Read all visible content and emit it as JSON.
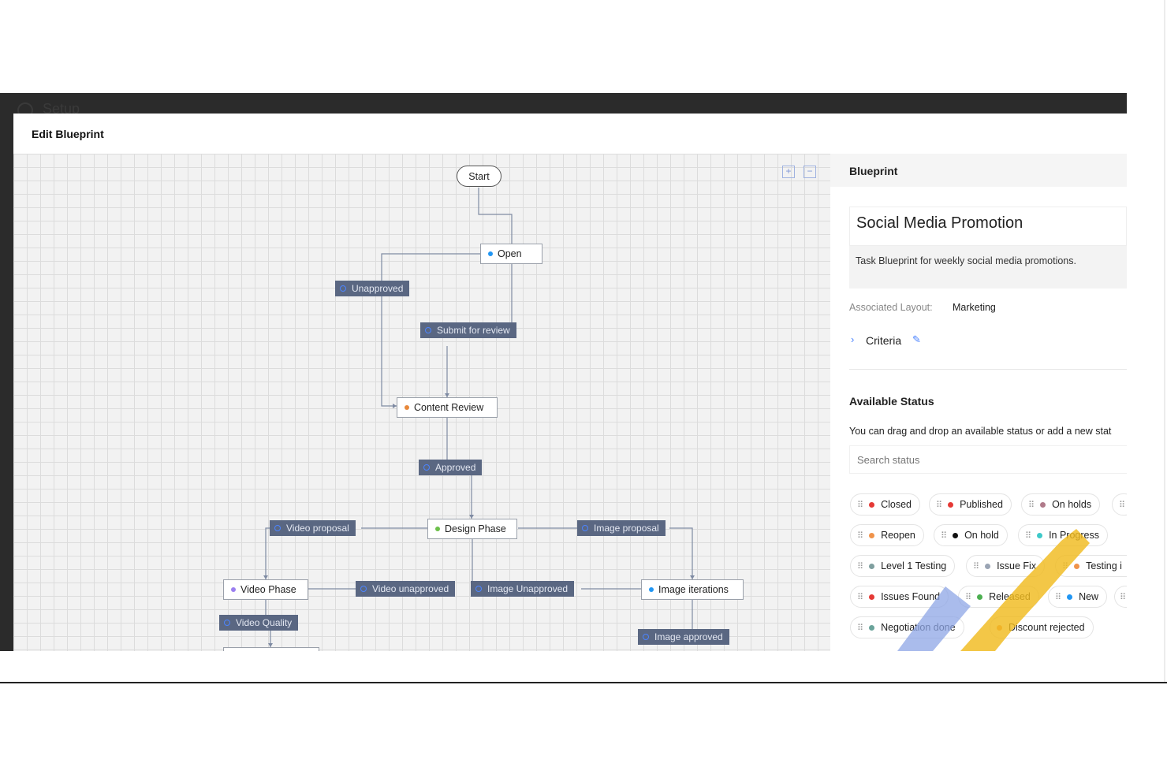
{
  "window": {
    "title": "Setup"
  },
  "editor": {
    "title": "Edit Blueprint"
  },
  "zoom": {
    "in": "+",
    "out": "−"
  },
  "diagram": {
    "nodes": [
      {
        "id": "start",
        "label": "Start",
        "color": ""
      },
      {
        "id": "open",
        "label": "Open",
        "color": "#2196f3"
      },
      {
        "id": "content-review",
        "label": "Content Review",
        "color": "#e8883a"
      },
      {
        "id": "design-phase",
        "label": "Design Phase",
        "color": "#6cc04a"
      },
      {
        "id": "video-phase",
        "label": "Video Phase",
        "color": "#9b7ff0"
      },
      {
        "id": "image-iterations",
        "label": "Image iterations",
        "color": "#2196f3"
      }
    ],
    "transitions": [
      {
        "id": "unapproved",
        "label": "Unapproved"
      },
      {
        "id": "submit-for-review",
        "label": "Submit for review"
      },
      {
        "id": "approved",
        "label": "Approved"
      },
      {
        "id": "video-proposal",
        "label": "Video proposal"
      },
      {
        "id": "image-proposal",
        "label": "Image proposal"
      },
      {
        "id": "video-unapproved",
        "label": "Video unapproved"
      },
      {
        "id": "image-unapproved",
        "label": "Image Unapproved"
      },
      {
        "id": "video-quality",
        "label": "Video Quality"
      },
      {
        "id": "image-approved",
        "label": "Image approved"
      }
    ]
  },
  "sidebar": {
    "header": "Blueprint",
    "name": "Social Media Promotion",
    "description": "Task Blueprint for weekly social media promotions.",
    "associated_layout_label": "Associated Layout:",
    "associated_layout_value": "Marketing",
    "criteria_label": "Criteria",
    "available_status_title": "Available Status",
    "available_status_hint": "You can drag and drop an available status or add a new stat",
    "search_placeholder": "Search status",
    "statuses": [
      {
        "label": "Closed",
        "color": "#e53935"
      },
      {
        "label": "Published",
        "color": "#e53935"
      },
      {
        "label": "On holds",
        "color": "#b07a8a"
      },
      {
        "label": "Reopen",
        "color": "#f0934a"
      },
      {
        "label": "On hold",
        "color": "#111111"
      },
      {
        "label": "In Progress",
        "color": "#3ec9c9"
      },
      {
        "label": "Level 1 Testing",
        "color": "#7f9f9f"
      },
      {
        "label": "Issue Fix",
        "color": "#9aa4b4"
      },
      {
        "label": "Testing i",
        "color": "#f0934a"
      },
      {
        "label": "Issues Found",
        "color": "#e53935"
      },
      {
        "label": "Released",
        "color": "#4caf50"
      },
      {
        "label": "New",
        "color": "#2196f3"
      },
      {
        "label": "Negotiation done",
        "color": "#6aa39a"
      },
      {
        "label": "Discount rejected",
        "color": "#f0934a"
      }
    ]
  }
}
